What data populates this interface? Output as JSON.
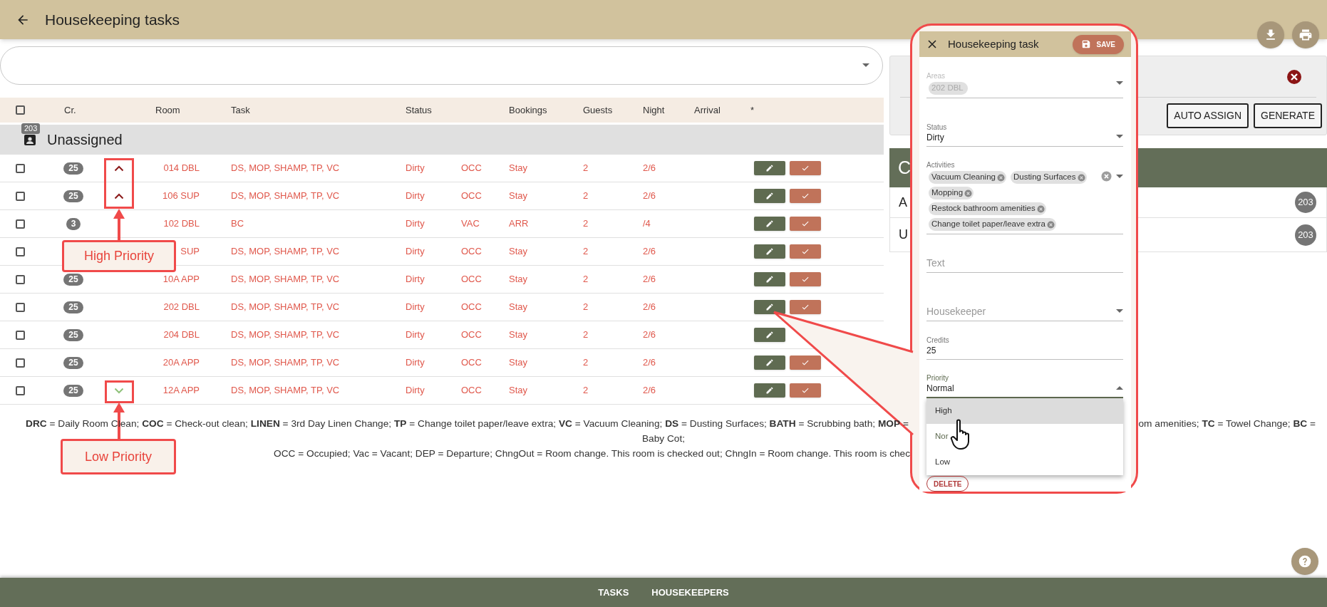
{
  "header": {
    "title": "Housekeeping tasks"
  },
  "table": {
    "select_all_checked": false,
    "columns": [
      "Cr.",
      "Room",
      "Task",
      "Status",
      "Bookings",
      "Guests",
      "Night",
      "Arrival",
      "*"
    ],
    "group": {
      "label": "Unassigned",
      "count": "203"
    },
    "rows": [
      {
        "checked": false,
        "credits": "25",
        "high_priority": true,
        "low_priority": false,
        "room": "014 DBL",
        "task": "DS, MOP, SHAMP, TP, VC",
        "status": "Dirty",
        "occupancy": "OCC",
        "booking": "Stay",
        "guests": "2",
        "night": "2/6",
        "actions": [
          {
            "kind": "edit"
          },
          {
            "kind": "done"
          }
        ]
      },
      {
        "checked": false,
        "credits": "25",
        "high_priority": true,
        "low_priority": false,
        "room": "106 SUP",
        "task": "DS, MOP, SHAMP, TP, VC",
        "status": "Dirty",
        "occupancy": "OCC",
        "booking": "Stay",
        "guests": "2",
        "night": "2/6",
        "actions": [
          {
            "kind": "edit"
          },
          {
            "kind": "done"
          }
        ]
      },
      {
        "checked": false,
        "credits": "3",
        "high_priority": false,
        "low_priority": false,
        "room": "102 DBL",
        "task": "BC",
        "status": "Dirty",
        "occupancy": "VAC",
        "booking": "ARR",
        "guests": "2",
        "night": "/4",
        "actions": [
          {
            "kind": "edit"
          },
          {
            "kind": "done"
          }
        ]
      },
      {
        "checked": false,
        "high_priority": false,
        "low_priority": false,
        "room": "SUP",
        "task": "DS, MOP, SHAMP, TP, VC",
        "status": "Dirty",
        "occupancy": "OCC",
        "booking": "Stay",
        "guests": "2",
        "night": "2/6",
        "actions": [
          {
            "kind": "edit"
          },
          {
            "kind": "done"
          }
        ]
      },
      {
        "checked": false,
        "credits": "25",
        "high_priority": false,
        "low_priority": false,
        "room": "10A APP",
        "task": "DS, MOP, SHAMP, TP, VC",
        "status": "Dirty",
        "occupancy": "OCC",
        "booking": "Stay",
        "guests": "2",
        "night": "2/6",
        "actions": [
          {
            "kind": "edit"
          },
          {
            "kind": "done"
          }
        ]
      },
      {
        "checked": false,
        "credits": "25",
        "high_priority": false,
        "low_priority": false,
        "room": "202 DBL",
        "task": "DS, MOP, SHAMP, TP, VC",
        "status": "Dirty",
        "occupancy": "OCC",
        "booking": "Stay",
        "guests": "2",
        "night": "2/6",
        "actions": [
          {
            "kind": "edit"
          },
          {
            "kind": "done"
          }
        ]
      },
      {
        "checked": false,
        "credits": "25",
        "high_priority": false,
        "low_priority": false,
        "room": "204 DBL",
        "task": "DS, MOP, SHAMP, TP, VC",
        "status": "Dirty",
        "occupancy": "OCC",
        "booking": "Stay",
        "guests": "2",
        "night": "2/6",
        "actions": [
          {
            "kind": "edit"
          }
        ]
      },
      {
        "checked": false,
        "credits": "25",
        "high_priority": false,
        "low_priority": false,
        "room": "20A APP",
        "task": "DS, MOP, SHAMP, TP, VC",
        "status": "Dirty",
        "occupancy": "OCC",
        "booking": "Stay",
        "guests": "2",
        "night": "2/6",
        "actions": [
          {
            "kind": "edit"
          },
          {
            "kind": "done"
          }
        ]
      },
      {
        "checked": false,
        "credits": "25",
        "high_priority": false,
        "low_priority": true,
        "room": "12A APP",
        "task": "DS, MOP, SHAMP, TP, VC",
        "status": "Dirty",
        "occupancy": "OCC",
        "booking": "Stay",
        "guests": "2",
        "night": "2/6",
        "actions": [
          {
            "kind": "edit"
          },
          {
            "kind": "done"
          }
        ]
      }
    ]
  },
  "legend": {
    "line_1_left": "**DRC** = Daily Room Clean; **COC** = Check-out clean; **LINEN** = 3rd Day Linen Change; **TP** = Change toilet paper/leave extra; **VC** = Vacuum Cleaning; **DS** = Dusting Surfaces; **BATH** = Scrubbing bath; **MOP** =",
    "line_1_right": "om amenities; **TC** = Towel Change; **BC** =",
    "line_2": "Baby Cot;",
    "line_3": "OCC = Occupied; Vac = Vacant; DEP = Departure; ChngOut = Room change. This room is checked out; ChngIn = Room change. This room is chec"
  },
  "side_panel": {
    "buttons": [
      "AUTO ASSIGN",
      "GENERATE"
    ],
    "list_header": "C",
    "rows": [
      {
        "label": "A",
        "count": "203"
      },
      {
        "label": "U",
        "count": "203"
      }
    ]
  },
  "dialog": {
    "title": "Housekeeping task",
    "save": "SAVE",
    "fields": [
      {
        "kind": "chips",
        "label": "Areas",
        "disabled": true,
        "chips": [
          "202 DBL"
        ]
      },
      {
        "kind": "select",
        "label": "Status",
        "value": "Dirty"
      },
      {
        "kind": "chips",
        "label": "Activities",
        "disabled": false,
        "clearable": true,
        "chips": [
          "Vacuum Cleaning",
          "Dusting Surfaces",
          "Mopping",
          "Restock bathroom amenities",
          "Change toilet paper/leave extra"
        ]
      },
      {
        "kind": "text",
        "placeholder": "Text"
      },
      {
        "kind": "select",
        "placeholder": "Housekeeper"
      },
      {
        "kind": "text",
        "label": "Credits",
        "value": "25"
      },
      {
        "kind": "select",
        "label": "Priority",
        "value": "Normal",
        "expanded": true,
        "options": [
          {
            "label": "High",
            "selected": false,
            "hovered": true
          },
          {
            "label": "Nor",
            "selected": true,
            "hovered": false
          },
          {
            "label": "Low",
            "selected": false,
            "hovered": false
          }
        ]
      }
    ],
    "delete": "DELETE"
  },
  "nav": [
    {
      "label": "TASKS"
    },
    {
      "label": "HOUSEKEEPERS"
    }
  ],
  "annotations": [
    {
      "label": "High Priority"
    },
    {
      "label": "Low Priority"
    }
  ]
}
